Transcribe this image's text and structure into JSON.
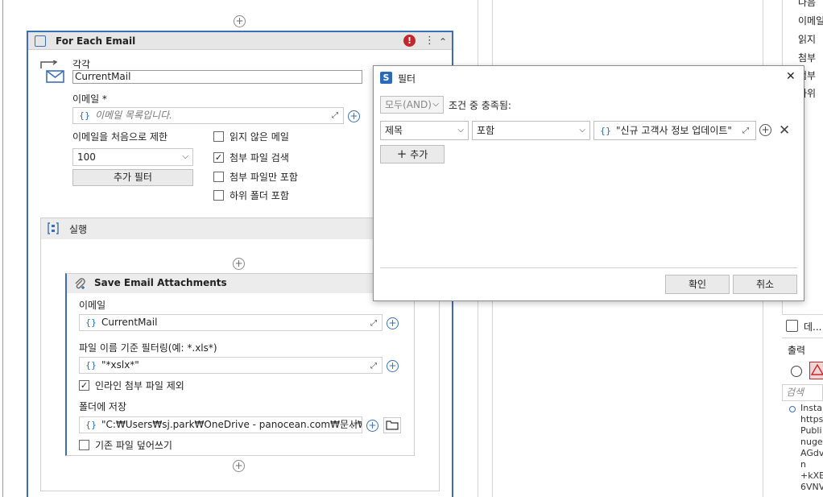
{
  "for_each": {
    "title": "For Each Email",
    "each_label": "각각",
    "each_value": "CurrentMail",
    "email_label": "이메일 *",
    "email_placeholder": "이메일 목록입니다.",
    "limit_label": "이메일을 처음으로 제한",
    "limit_value": "100",
    "extra_filter_button": "추가 필터",
    "unread_label": "읽지 않은 메일",
    "search_attach_label": "첨부 파일 검색",
    "attach_only_label": "첨부 파일만 포함",
    "subfolder_label": "하위 폴더 포함",
    "unread_checked": false,
    "search_attach_checked": true,
    "attach_only_checked": false,
    "subfolder_checked": false
  },
  "execute": {
    "title": "실행"
  },
  "save_attachments": {
    "title": "Save Email Attachments",
    "email_label": "이메일",
    "email_value": "CurrentMail",
    "filter_label": "파일 이름 기준 필터링(예: *.xls*)",
    "filter_value": "\"*xslx*\"",
    "exclude_inline_label": "인라인 첨부 파일 제외",
    "exclude_inline_checked": true,
    "folder_label": "폴더에 저장",
    "folder_value": "\"C:₩Users₩sj.park₩OneDrive - panocean.com₩문서₩Ui",
    "overwrite_label": "기존 파일 덮어쓰기",
    "overwrite_checked": false
  },
  "filter_dialog": {
    "title": "필터",
    "mode_value": "모두(AND)",
    "condition_text": "조건 중 충족됨:",
    "field_value": "제목",
    "operator_value": "포함",
    "expression_value": "\"신규 고객사 정보 업데이트\"",
    "add_button": "추가",
    "ok_button": "확인",
    "cancel_button": "취소"
  },
  "right_panel": {
    "list_items": [
      "나음 ",
      "이메일",
      "읽지 ",
      "첨부 ",
      "첨부 ",
      "하위 "
    ],
    "data_tab": "데...",
    "output_title": "출력",
    "search_placeholder": "검색",
    "log_lines": [
      "Instal",
      "https",
      "Publi",
      "nuget",
      "AGdv",
      "n",
      "+kXE",
      "6VNV"
    ]
  },
  "icons": {
    "plus": "+",
    "error": "!",
    "more": "⋮",
    "collapse": "⌃",
    "close": "✕",
    "expand": "⤢",
    "check": "✓",
    "chevron": "⌵"
  }
}
